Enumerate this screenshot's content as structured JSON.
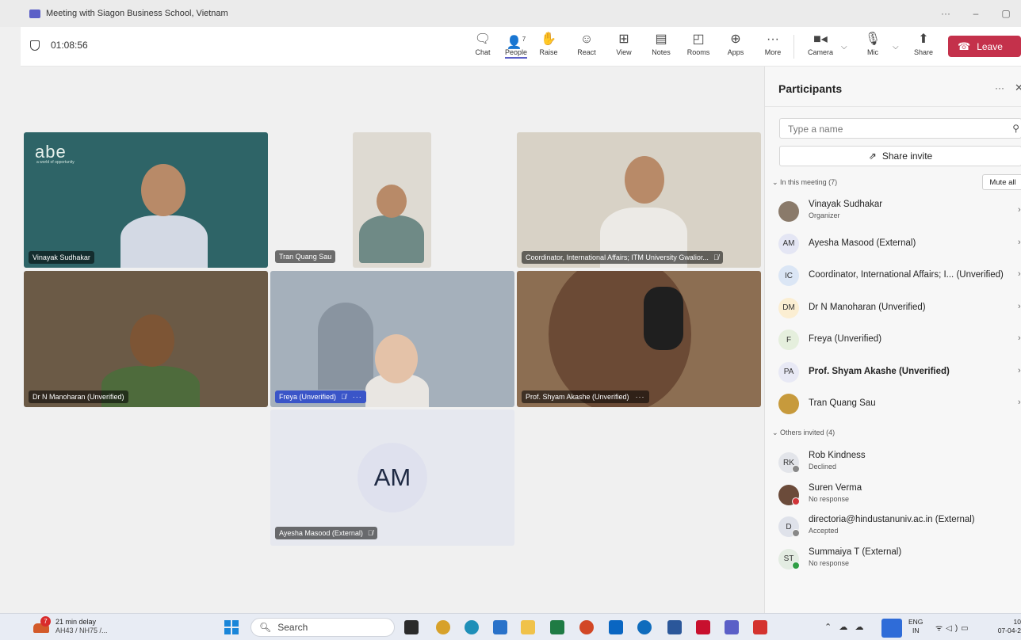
{
  "window": {
    "title": "Meeting with Siagon Business School, Vietnam",
    "controls": [
      "···",
      "–",
      "▢"
    ]
  },
  "toolbar": {
    "timer": "01:08:56",
    "people_count": "7",
    "buttons": [
      {
        "id": "chat",
        "label": "Chat",
        "icon": "chat-icon"
      },
      {
        "id": "people",
        "label": "People",
        "icon": "people-icon"
      },
      {
        "id": "raise",
        "label": "Raise",
        "icon": "hand-icon"
      },
      {
        "id": "react",
        "label": "React",
        "icon": "smile-icon"
      },
      {
        "id": "view",
        "label": "View",
        "icon": "grid-icon"
      },
      {
        "id": "notes",
        "label": "Notes",
        "icon": "notes-icon"
      },
      {
        "id": "rooms",
        "label": "Rooms",
        "icon": "rooms-icon"
      },
      {
        "id": "apps",
        "label": "Apps",
        "icon": "plus-icon"
      },
      {
        "id": "more",
        "label": "More",
        "icon": "ellipsis-icon"
      },
      {
        "id": "camera",
        "label": "Camera",
        "icon": "camera-icon"
      },
      {
        "id": "mic",
        "label": "Mic",
        "icon": "mic-icon"
      },
      {
        "id": "share",
        "label": "Share",
        "icon": "share-icon"
      }
    ],
    "leave_label": "Leave"
  },
  "tiles": [
    {
      "id": "vinayak",
      "name": "Vinayak Sudhakar"
    },
    {
      "id": "tran",
      "name": "Tran Quang Sau"
    },
    {
      "id": "coordinator",
      "name": "Coordinator, International Affairs; ITM University Gwalior..."
    },
    {
      "id": "manoharan",
      "name": "Dr N Manoharan (Unverified)"
    },
    {
      "id": "freya",
      "name": "Freya (Unverified)"
    },
    {
      "id": "shyam",
      "name": "Prof. Shyam Akashe (Unverified)"
    },
    {
      "id": "ayesha",
      "name": "Ayesha Masood (External)",
      "initials": "AM"
    }
  ],
  "background_logo": {
    "brand": "abe",
    "tagline": "a world of opportunity"
  },
  "panel": {
    "title": "Participants",
    "search_placeholder": "Type a name",
    "share_invite": "Share invite",
    "in_meeting_label": "In this meeting (7)",
    "mute_all": "Mute all",
    "in_meeting": [
      {
        "initials": "",
        "name": "Vinayak Sudhakar",
        "sub": "Organizer",
        "avatar_color": "#8a7a6a"
      },
      {
        "initials": "AM",
        "name": "Ayesha Masood (External)",
        "sub": "",
        "avatar_color": "#e4e6f4"
      },
      {
        "initials": "IC",
        "name": "Coordinator, International Affairs; I... (Unverified)",
        "sub": "",
        "avatar_color": "#dbe6f5"
      },
      {
        "initials": "DM",
        "name": "Dr N Manoharan (Unverified)",
        "sub": "",
        "avatar_color": "#fbeed2"
      },
      {
        "initials": "F",
        "name": "Freya (Unverified)",
        "sub": "",
        "avatar_color": "#e5efdd"
      },
      {
        "initials": "PA",
        "name": "Prof. Shyam Akashe (Unverified)",
        "sub": "",
        "avatar_color": "#e8e9f5"
      },
      {
        "initials": "",
        "name": "Tran Quang Sau",
        "sub": "",
        "avatar_color": "#c79a3c"
      }
    ],
    "others_label": "Others invited (4)",
    "others": [
      {
        "initials": "RK",
        "name": "Rob Kindness",
        "sub": "Declined",
        "avatar_color": "#e3e5ea",
        "status_color": "#888888"
      },
      {
        "initials": "",
        "name": "Suren Verma",
        "sub": "No response",
        "avatar_color": "#6b4b3a",
        "status_color": "#d13438"
      },
      {
        "initials": "D",
        "name": "directoria@hindustanuniv.ac.in (External)",
        "sub": "Accepted",
        "avatar_color": "#dfe2ea",
        "status_color": "#888888"
      },
      {
        "initials": "ST",
        "name": "Summaiya T (External)",
        "sub": "No response",
        "avatar_color": "#e3ece2",
        "status_color": "#2e9e44"
      }
    ]
  },
  "taskbar": {
    "traffic_badge": "7",
    "traffic_title": "21 min delay",
    "traffic_sub": "AH43 / NH75 /...",
    "search_label": "Search",
    "lang_top": "ENG",
    "lang_bottom": "IN",
    "time": "10",
    "date": "07-04-2"
  },
  "colors": {
    "accent": "#5b5fc7",
    "leave": "#c4314b",
    "tile_logo_bg": "#2e6467"
  }
}
